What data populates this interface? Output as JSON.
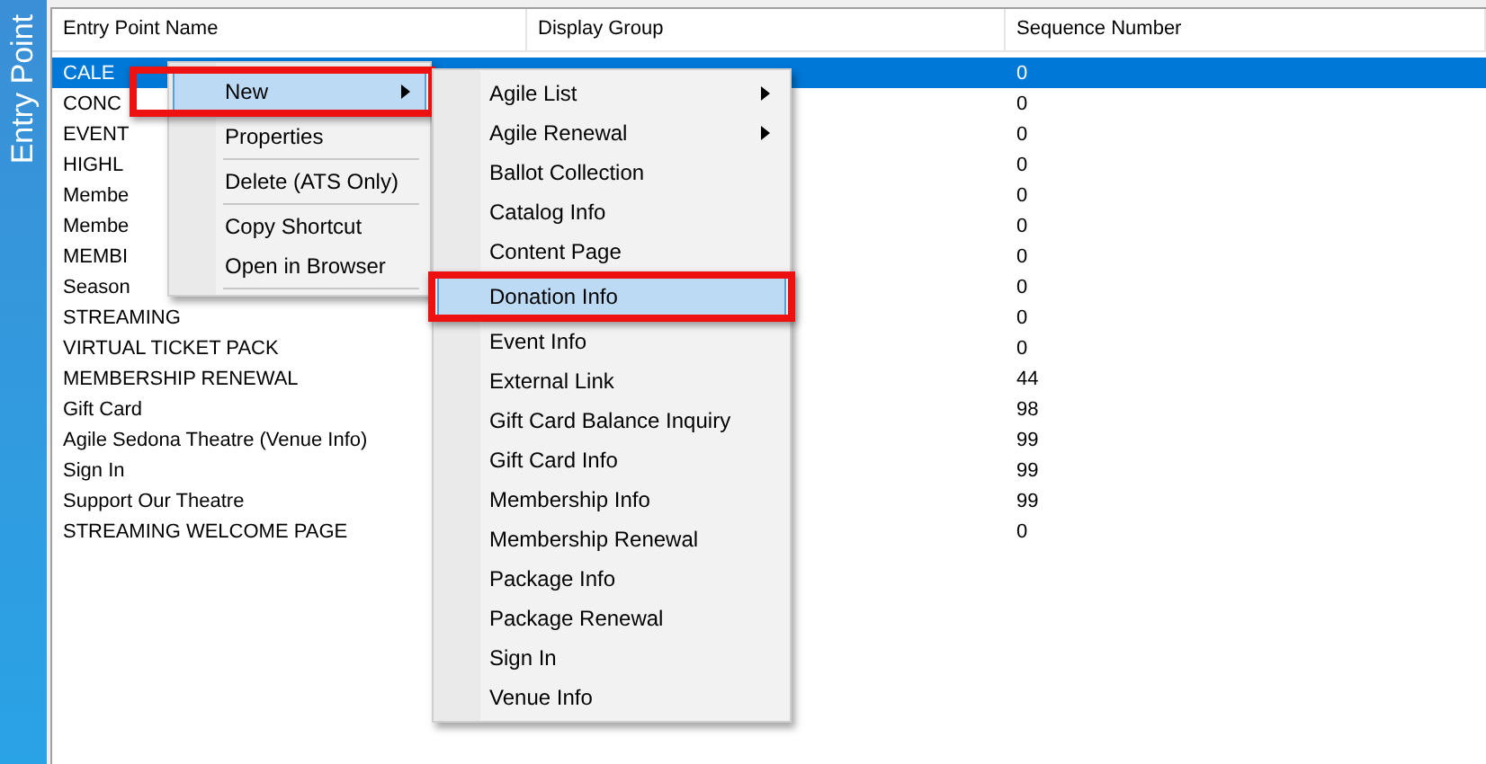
{
  "side_tab": {
    "label": "Entry Point"
  },
  "table": {
    "columns": [
      "Entry Point Name",
      "Display Group",
      "Sequence Number"
    ],
    "rows": [
      {
        "name": "CALE",
        "sequence": "0",
        "selected": true
      },
      {
        "name": "CONC",
        "sequence": "0",
        "selected": false
      },
      {
        "name": "EVENT",
        "sequence": "0",
        "selected": false
      },
      {
        "name": "HIGHL",
        "sequence": "0",
        "selected": false
      },
      {
        "name": "Membe",
        "sequence": "0",
        "selected": false
      },
      {
        "name": "Membe",
        "sequence": "0",
        "selected": false
      },
      {
        "name": "MEMBI",
        "sequence": "0",
        "selected": false
      },
      {
        "name": "Season",
        "sequence": "0",
        "selected": false
      },
      {
        "name": "STREAMING",
        "sequence": "0",
        "selected": false
      },
      {
        "name": "VIRTUAL TICKET PACK",
        "sequence": "0",
        "selected": false
      },
      {
        "name": "MEMBERSHIP RENEWAL",
        "sequence": "44",
        "selected": false
      },
      {
        "name": "Gift Card",
        "sequence": "98",
        "selected": false
      },
      {
        "name": "Agile Sedona Theatre (Venue Info)",
        "sequence": "99",
        "selected": false
      },
      {
        "name": "Sign In",
        "sequence": "99",
        "selected": false
      },
      {
        "name": "Support Our Theatre",
        "sequence": "99",
        "selected": false
      },
      {
        "name": "STREAMING WELCOME PAGE",
        "sequence": "0",
        "selected": false
      }
    ]
  },
  "context_menu": {
    "items": [
      {
        "kind": "item",
        "label": "New",
        "highlighted": true,
        "has_submenu": true,
        "callout": true
      },
      {
        "kind": "item",
        "label": "Properties",
        "highlighted": false,
        "has_submenu": false,
        "callout": false
      },
      {
        "kind": "separator"
      },
      {
        "kind": "item",
        "label": "Delete (ATS Only)",
        "highlighted": false,
        "has_submenu": false,
        "callout": false
      },
      {
        "kind": "separator"
      },
      {
        "kind": "item",
        "label": "Copy Shortcut",
        "highlighted": false,
        "has_submenu": false,
        "callout": false
      },
      {
        "kind": "item",
        "label": "Open in Browser",
        "highlighted": false,
        "has_submenu": false,
        "callout": false
      },
      {
        "kind": "separator"
      }
    ]
  },
  "submenu": {
    "items": [
      {
        "kind": "item",
        "label": "Agile List",
        "highlighted": false,
        "has_submenu": true,
        "callout": false
      },
      {
        "kind": "item",
        "label": "Agile Renewal",
        "highlighted": false,
        "has_submenu": true,
        "callout": false
      },
      {
        "kind": "item",
        "label": "Ballot Collection",
        "highlighted": false,
        "has_submenu": false,
        "callout": false
      },
      {
        "kind": "item",
        "label": "Catalog Info",
        "highlighted": false,
        "has_submenu": false,
        "callout": false
      },
      {
        "kind": "item",
        "label": "Content Page",
        "highlighted": false,
        "has_submenu": false,
        "callout": false
      },
      {
        "kind": "item",
        "label": "Donation Info",
        "highlighted": true,
        "has_submenu": false,
        "callout": true
      },
      {
        "kind": "item",
        "label": "Event Info",
        "highlighted": false,
        "has_submenu": false,
        "callout": false
      },
      {
        "kind": "item",
        "label": "External Link",
        "highlighted": false,
        "has_submenu": false,
        "callout": false
      },
      {
        "kind": "item",
        "label": "Gift Card Balance Inquiry",
        "highlighted": false,
        "has_submenu": false,
        "callout": false
      },
      {
        "kind": "item",
        "label": "Gift Card Info",
        "highlighted": false,
        "has_submenu": false,
        "callout": false
      },
      {
        "kind": "item",
        "label": "Membership Info",
        "highlighted": false,
        "has_submenu": false,
        "callout": false
      },
      {
        "kind": "item",
        "label": "Membership Renewal",
        "highlighted": false,
        "has_submenu": false,
        "callout": false
      },
      {
        "kind": "item",
        "label": "Package Info",
        "highlighted": false,
        "has_submenu": false,
        "callout": false
      },
      {
        "kind": "item",
        "label": "Package Renewal",
        "highlighted": false,
        "has_submenu": false,
        "callout": false
      },
      {
        "kind": "item",
        "label": "Sign In",
        "highlighted": false,
        "has_submenu": false,
        "callout": false
      },
      {
        "kind": "item",
        "label": "Venue Info",
        "highlighted": false,
        "has_submenu": false,
        "callout": false
      }
    ]
  }
}
